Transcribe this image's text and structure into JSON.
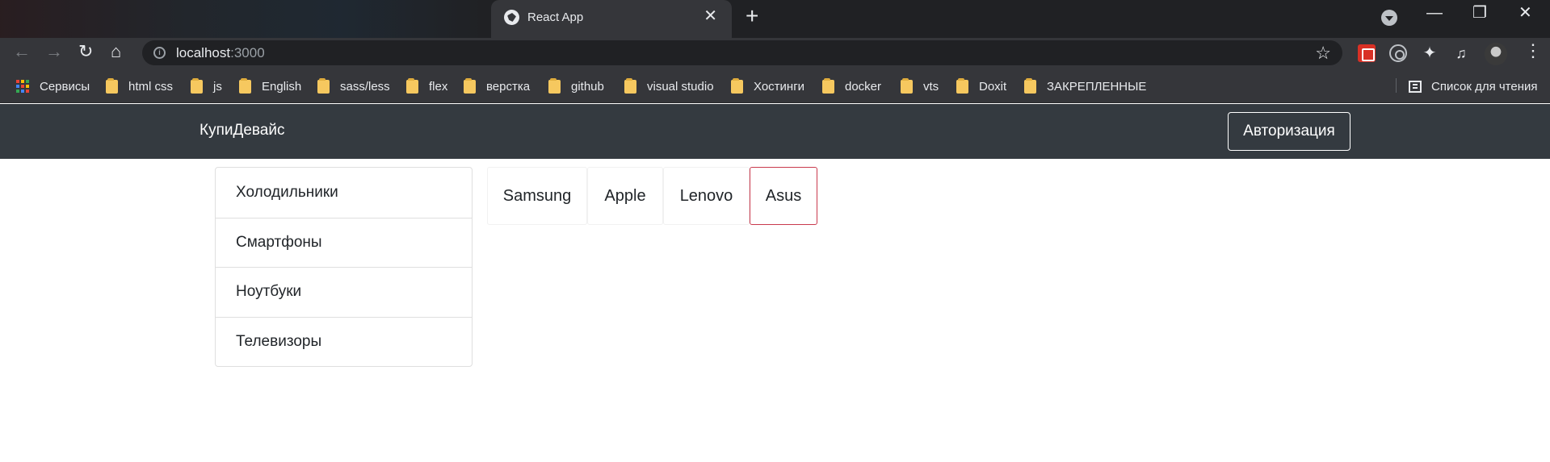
{
  "browser": {
    "tab_title": "React App",
    "tab_close": "✕",
    "new_tab": "+",
    "window_controls": [
      "—",
      "❐",
      "✕"
    ],
    "url_host": "localhost",
    "url_port": ":3000",
    "nav_glyphs": {
      "back": "←",
      "forward": "→",
      "reload": "↻",
      "home": "⌂"
    },
    "bookmark_glyph": "☆",
    "menu_glyph": "⋮",
    "bookmarks": [
      {
        "label": "Сервисы",
        "icon": "apps-icon"
      },
      {
        "label": "html css",
        "icon": "folder-icon"
      },
      {
        "label": "js",
        "icon": "folder-icon"
      },
      {
        "label": "English",
        "icon": "folder-icon"
      },
      {
        "label": "sass/less",
        "icon": "folder-icon"
      },
      {
        "label": "flex",
        "icon": "folder-icon"
      },
      {
        "label": "верстка",
        "icon": "folder-icon"
      },
      {
        "label": "github",
        "icon": "folder-icon"
      },
      {
        "label": "visual studio",
        "icon": "folder-icon"
      },
      {
        "label": "Хостинги",
        "icon": "folder-icon"
      },
      {
        "label": "docker",
        "icon": "folder-icon"
      },
      {
        "label": "vts",
        "icon": "folder-icon"
      },
      {
        "label": "Doxit",
        "icon": "folder-icon"
      },
      {
        "label": "ЗАКРЕПЛЕННЫЕ",
        "icon": "folder-icon"
      }
    ],
    "reading_list": "Список для чтения"
  },
  "app": {
    "brand": "КупиДевайс",
    "auth_button": "Авторизация",
    "types": [
      "Холодильники",
      "Смартфоны",
      "Ноутбуки",
      "Телевизоры"
    ],
    "brands": [
      "Samsung",
      "Apple",
      "Lenovo",
      "Asus"
    ],
    "selected_brand": "Asus",
    "colors": {
      "navbar": "#343a40",
      "selected_border": "#c9394d"
    }
  }
}
